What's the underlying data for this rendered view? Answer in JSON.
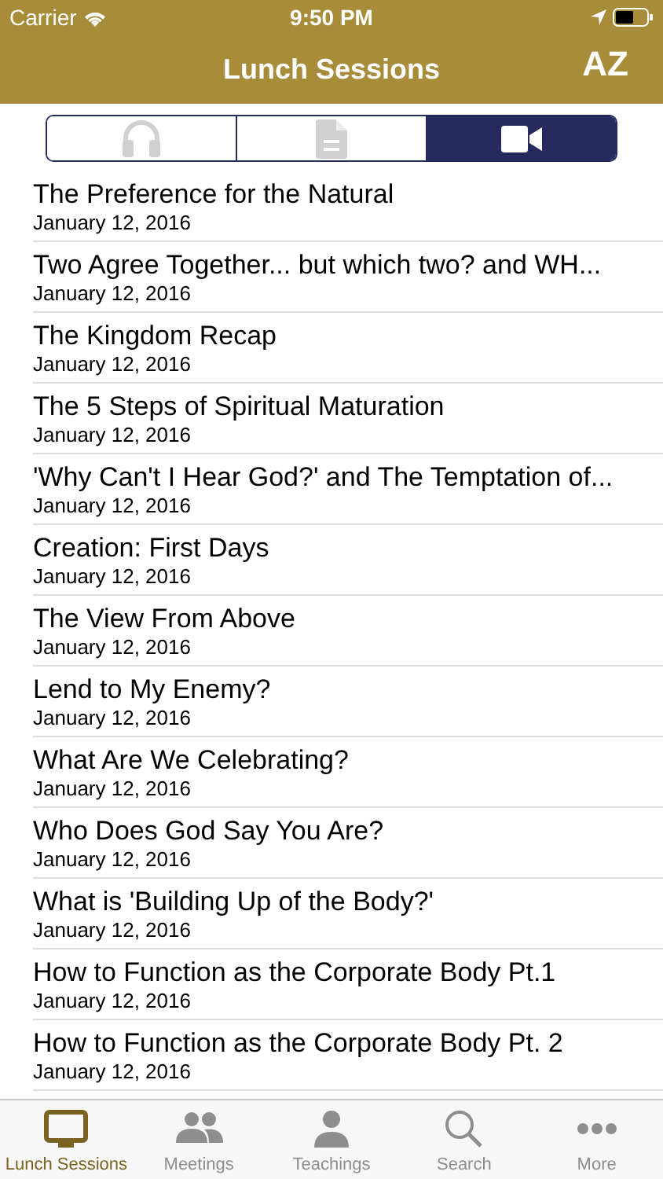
{
  "status_bar": {
    "carrier": "Carrier",
    "time": "9:50 PM"
  },
  "nav_bar": {
    "title": "Lunch Sessions",
    "sort_label": "AZ"
  },
  "segments": [
    {
      "kind": "audio",
      "selected": false
    },
    {
      "kind": "document",
      "selected": false
    },
    {
      "kind": "video",
      "selected": true
    }
  ],
  "rows": [
    {
      "title": "The Preference for the Natural",
      "date": "January 12, 2016"
    },
    {
      "title": "Two Agree Together... but which two? and WH...",
      "date": "January 12, 2016"
    },
    {
      "title": "The Kingdom Recap",
      "date": "January 12, 2016"
    },
    {
      "title": "The 5 Steps of Spiritual Maturation",
      "date": "January 12, 2016"
    },
    {
      "title": "'Why Can't I Hear God?' and The Temptation of...",
      "date": "January 12, 2016"
    },
    {
      "title": "Creation: First Days",
      "date": "January 12, 2016"
    },
    {
      "title": "The View From Above",
      "date": "January 12, 2016"
    },
    {
      "title": "Lend to My Enemy?",
      "date": "January 12, 2016"
    },
    {
      "title": "What Are We Celebrating?",
      "date": "January 12, 2016"
    },
    {
      "title": "Who Does God Say You Are?",
      "date": "January 12, 2016"
    },
    {
      "title": "What is 'Building Up of the Body?'",
      "date": "January 12, 2016"
    },
    {
      "title": "How to Function as the Corporate Body Pt.1",
      "date": "January 12, 2016"
    },
    {
      "title": "How to Function as the Corporate Body Pt. 2",
      "date": "January 12, 2016"
    }
  ],
  "tab_bar": [
    {
      "kind": "tv",
      "label": "Lunch Sessions",
      "selected": true
    },
    {
      "kind": "people",
      "label": "Meetings",
      "selected": false
    },
    {
      "kind": "person",
      "label": "Teachings",
      "selected": false
    },
    {
      "kind": "search",
      "label": "Search",
      "selected": false
    },
    {
      "kind": "more",
      "label": "More",
      "selected": false
    }
  ]
}
